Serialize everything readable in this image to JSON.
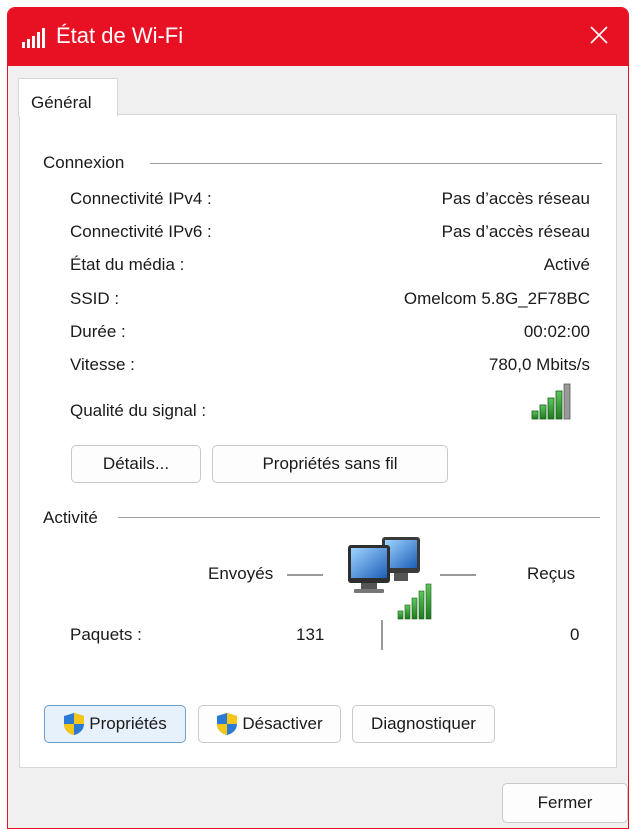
{
  "window": {
    "title": "État de Wi-Fi",
    "accent_color": "#e81123",
    "icon": "wifi-signal-icon",
    "close_icon": "close-icon"
  },
  "tabs": [
    {
      "label": "Général",
      "selected": true
    }
  ],
  "connexion": {
    "title": "Connexion",
    "rows": [
      {
        "label": "Connectivité IPv4 :",
        "value": "Pas d’accès réseau"
      },
      {
        "label": "Connectivité IPv6 :",
        "value": "Pas d’accès réseau"
      },
      {
        "label": "État du média :",
        "value": "Activé"
      },
      {
        "label": "SSID :",
        "value": "Omelcom 5.8G_2F78BC"
      },
      {
        "label": "Durée :",
        "value": "00:02:00"
      },
      {
        "label": "Vitesse :",
        "value": "780,0 Mbits/s"
      }
    ],
    "signal_label": "Qualité du signal :",
    "signal_bars": 5,
    "signal_icon": "signal-strength-icon",
    "details_button": "Détails...",
    "wireless_props_button": "Propriétés sans fil"
  },
  "activite": {
    "title": "Activité",
    "sent_label": "Envoyés",
    "received_label": "Reçus",
    "packets_label": "Paquets :",
    "packets_sent": "131",
    "packets_received": "0",
    "network_icon": "network-computers-icon"
  },
  "buttons": {
    "properties": "Propriétés",
    "disable": "Désactiver",
    "diagnose": "Diagnostiquer",
    "close": "Fermer",
    "shield_icon": "uac-shield-icon"
  }
}
